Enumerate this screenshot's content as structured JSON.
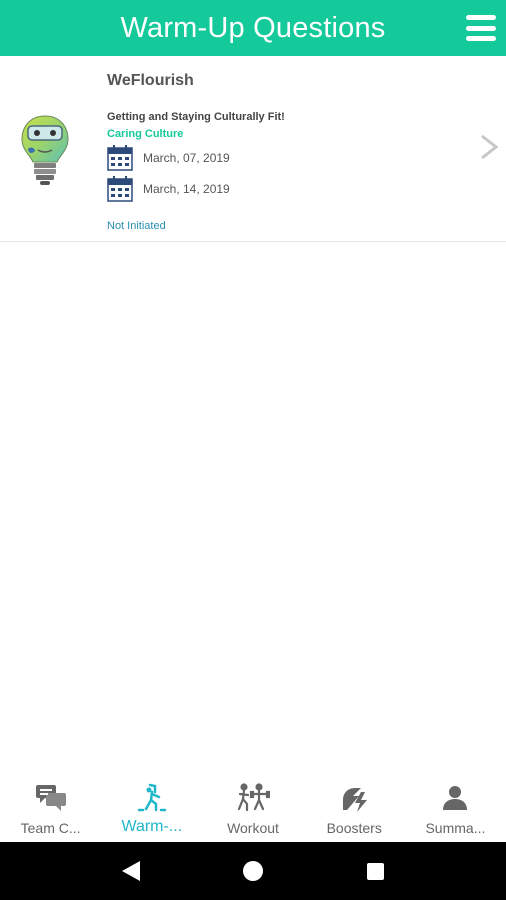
{
  "header": {
    "title": "Warm-Up Questions",
    "menu_icon": "hamburger-menu-icon"
  },
  "card": {
    "organization": "WeFlourish",
    "course_title": "Getting and Staying Culturally Fit!",
    "category": "Caring Culture",
    "start_date": "March, 07, 2019",
    "end_date": "March, 14, 2019",
    "status": "Not Initiated",
    "accent_color": "#14c99a",
    "status_color": "#2a8fb0"
  },
  "tabs": [
    {
      "label": "Team C...",
      "icon": "chat-icon",
      "active": false
    },
    {
      "label": "Warm-...",
      "icon": "warm-up-icon",
      "active": true
    },
    {
      "label": "Workout",
      "icon": "workout-icon",
      "active": false
    },
    {
      "label": "Boosters",
      "icon": "booster-icon",
      "active": false
    },
    {
      "label": "Summa...",
      "icon": "user-icon",
      "active": false
    }
  ],
  "colors": {
    "brand": "#14c99a",
    "active_tab": "#1fb7c9"
  }
}
